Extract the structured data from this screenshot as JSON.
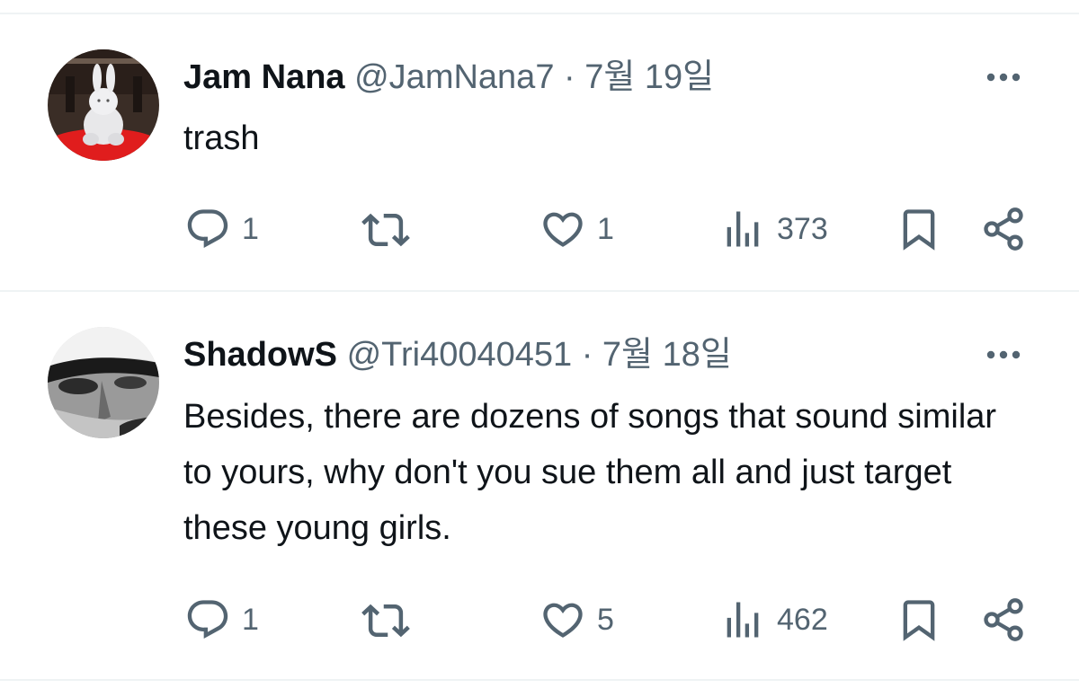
{
  "tweets": [
    {
      "display_name": "Jam Nana",
      "handle": "@JamNana7",
      "separator": "·",
      "date": "7월 19일",
      "text": "trash",
      "reply_count": "1",
      "like_count": "1",
      "view_count": "373",
      "avatar_icon": "white-rabbit-figure-avatar"
    },
    {
      "display_name": "ShadowS",
      "handle": "@Tri40040451",
      "separator": "·",
      "date": "7월 18일",
      "text": "Besides, there are dozens of songs that sound similar to yours, why don't you sue them all and just target these young girls.",
      "reply_count": "1",
      "like_count": "5",
      "view_count": "462",
      "avatar_icon": "grayscale-face-avatar"
    }
  ],
  "icons": [
    "more-icon",
    "reply-icon",
    "retweet-icon",
    "like-icon",
    "views-icon",
    "bookmark-icon",
    "share-icon"
  ],
  "colors": {
    "text_primary": "#0f1419",
    "text_secondary": "#536471",
    "divider": "#eff3f4"
  }
}
